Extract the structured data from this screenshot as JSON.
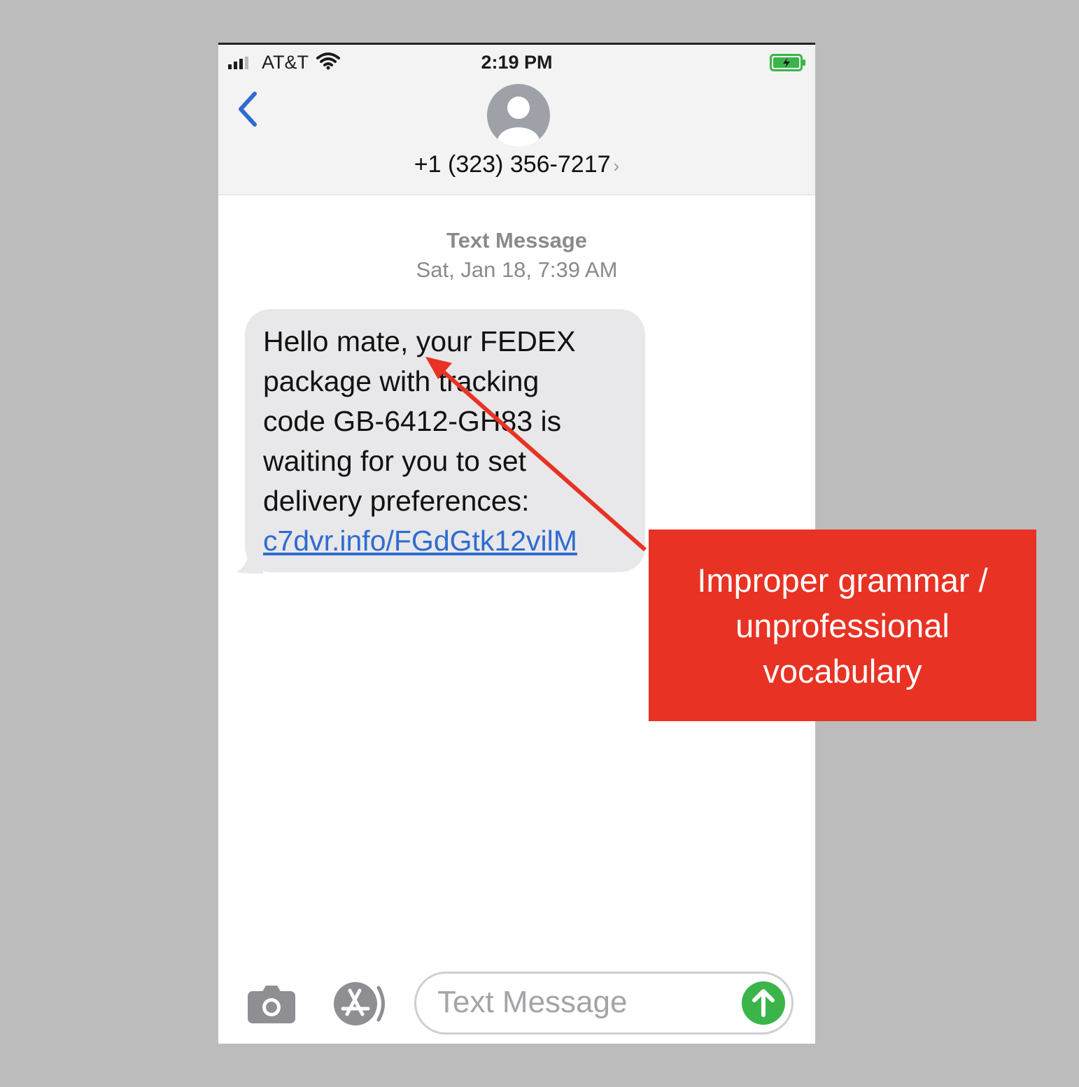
{
  "status_bar": {
    "carrier": "AT&T",
    "time": "2:19 PM"
  },
  "header": {
    "contact": "+1 (323) 356-7217",
    "contact_chevron": "›"
  },
  "conversation": {
    "service_label": "Text Message",
    "timestamp": "Sat, Jan 18, 7:39 AM",
    "message": {
      "text": "Hello mate, your FEDEX\npackage with tracking\ncode GB-6412-GH83 is\nwaiting for you to set\ndelivery preferences:",
      "link": "c7dvr.info/FGdGtk12vilM"
    }
  },
  "compose": {
    "placeholder": "Text Message"
  },
  "annotation": {
    "callout": "Improper grammar / unprofessional vocabulary",
    "color": "#e83223"
  },
  "icons": {
    "signal": "signal-icon",
    "wifi": "wifi-icon",
    "battery": "battery-charging-icon",
    "back": "chevron-left-icon",
    "avatar": "contact-avatar-icon",
    "camera": "camera-icon",
    "appstore": "app-store-icon",
    "send": "send-arrow-icon"
  }
}
